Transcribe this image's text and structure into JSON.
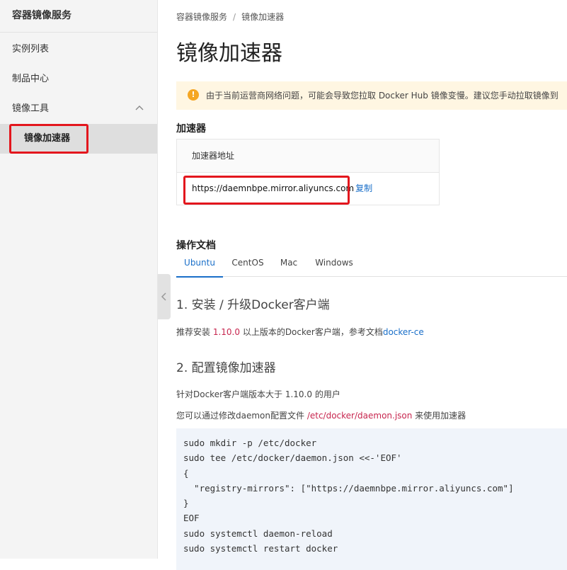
{
  "sidebar": {
    "title": "容器镜像服务",
    "items": [
      {
        "label": "实例列表"
      },
      {
        "label": "制品中心"
      }
    ],
    "group": {
      "label": "镜像工具",
      "expanded": true,
      "chevron_icon": "chevron-up-icon"
    },
    "active_item": {
      "label": "镜像加速器"
    }
  },
  "breadcrumb": {
    "root": "容器镜像服务",
    "separator": "/",
    "current": "镜像加速器"
  },
  "page": {
    "title": "镜像加速器"
  },
  "notice": {
    "icon": "warning-icon",
    "icon_glyph": "!",
    "text": "由于当前运营商网络问题，可能会导致您拉取 Docker Hub 镜像变慢。建议您手动拉取镜像到"
  },
  "accelerator": {
    "section_title": "加速器",
    "table_header": "加速器地址",
    "url": "https://daemnbpe.mirror.aliyuncs.com",
    "copy_label": "复制"
  },
  "docs": {
    "section_title": "操作文档",
    "tabs": [
      {
        "label": "Ubuntu",
        "active": true
      },
      {
        "label": "CentOS",
        "active": false
      },
      {
        "label": "Mac",
        "active": false
      },
      {
        "label": "Windows",
        "active": false
      }
    ],
    "step1": {
      "title": "1. 安装 / 升级Docker客户端",
      "text_before": "推荐安装 ",
      "version": "1.10.0",
      "text_after": " 以上版本的Docker客户端，参考文档",
      "link": "docker-ce"
    },
    "step2": {
      "title": "2. 配置镜像加速器",
      "line1": "针对Docker客户端版本大于 1.10.0 的用户",
      "line2_before": "您可以通过修改daemon配置文件 ",
      "line2_path": "/etc/docker/daemon.json",
      "line2_after": " 来使用加速器"
    },
    "code": "sudo mkdir -p /etc/docker\nsudo tee /etc/docker/daemon.json <<-'EOF'\n{\n  \"registry-mirrors\": [\"https://daemnbpe.mirror.aliyuncs.com\"]\n}\nEOF\nsudo systemctl daemon-reload\nsudo systemctl restart docker"
  },
  "colors": {
    "accent": "#1a6fc9",
    "highlight": "#e3161d",
    "notice_bg": "#fff6e2",
    "warning": "#f5a623"
  }
}
